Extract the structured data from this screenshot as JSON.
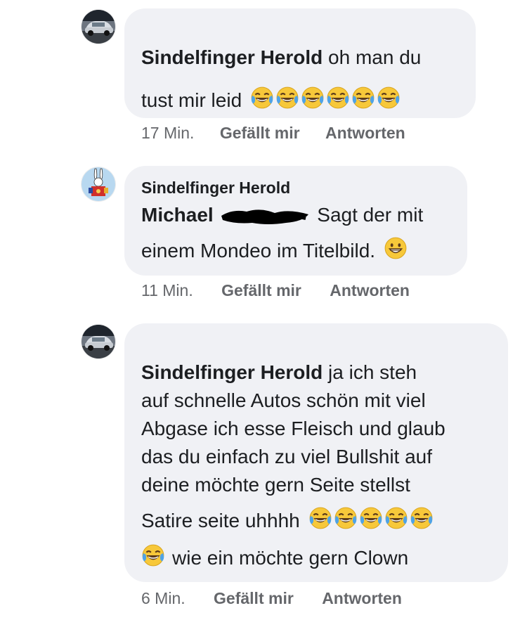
{
  "comments": [
    {
      "author": "Sindelfinger Herold",
      "text_lines": [
        "oh man du",
        "tust mir leid"
      ],
      "emoji_count": 6,
      "time": "17 Min.",
      "like": "Gefällt mir",
      "reply": "Antworten",
      "avatar": "car-avatar"
    },
    {
      "author": "Sindelfinger Herold",
      "mention": "Michael",
      "text_lines": [
        "Sagt der mit",
        "einem Mondeo im Titelbild."
      ],
      "emoji": "grinning-face",
      "time": "11 Min.",
      "like": "Gefällt mir",
      "reply": "Antworten",
      "avatar": "rabbit-avatar"
    },
    {
      "author": "Sindelfinger Herold",
      "text_lines": [
        "ja ich steh",
        "auf schnelle Autos schön mit viel",
        "Abgase ich esse Fleisch und glaub",
        "das du einfach zu viel Bullshit auf",
        "deine möchte gern Seite stellst",
        "Satire seite uhhhh",
        "wie ein möchte gern Clown"
      ],
      "emoji_count_line6": 5,
      "emoji_count_line7": 1,
      "time": "6 Min.",
      "like": "Gefällt mir",
      "reply": "Antworten",
      "avatar": "car-avatar"
    }
  ],
  "colors": {
    "bubble": "#f0f1f5",
    "meta": "#65676b",
    "emoji_yellow": "#f7c83a",
    "tear_blue": "#4fa3e6"
  }
}
